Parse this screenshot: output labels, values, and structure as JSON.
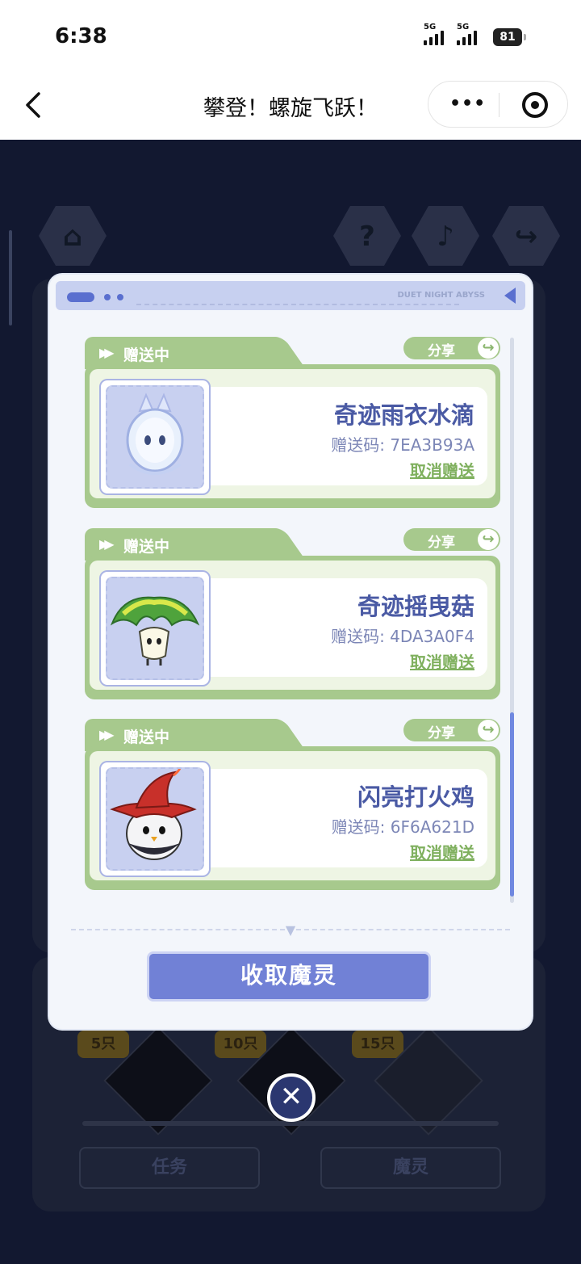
{
  "status_bar": {
    "time": "6:38",
    "signal_1": "5G",
    "signal_2": "5G",
    "battery": "81"
  },
  "nav": {
    "title": "攀登！螺旋飞跃！",
    "more_label": "•••"
  },
  "background": {
    "hex_buttons": [
      {
        "icon": "home-icon",
        "glyph": "⌂"
      },
      {
        "icon": "help-icon",
        "glyph": "?"
      },
      {
        "icon": "music-icon",
        "glyph": "♪"
      },
      {
        "icon": "share-icon",
        "glyph": "↪"
      }
    ],
    "milestones": [
      "5只",
      "10只",
      "15只"
    ],
    "buttons": {
      "tasks": "任务",
      "spirits": "魔灵"
    }
  },
  "modal": {
    "brand": "DUET NIGHT ABYSS",
    "cards": [
      {
        "status": "赠送中",
        "share": "分享",
        "name": "奇迹雨衣水滴",
        "code": "赠送码: 7EA3B93A",
        "cancel": "取消赠送"
      },
      {
        "status": "赠送中",
        "share": "分享",
        "name": "奇迹摇曳菇",
        "code": "赠送码: 4DA3A0F4",
        "cancel": "取消赠送"
      },
      {
        "status": "赠送中",
        "share": "分享",
        "name": "闪亮打火鸡",
        "code": "赠送码: 6F6A621D",
        "cancel": "取消赠送"
      }
    ],
    "collect_button": "收取魔灵",
    "close_glyph": "✕"
  }
}
